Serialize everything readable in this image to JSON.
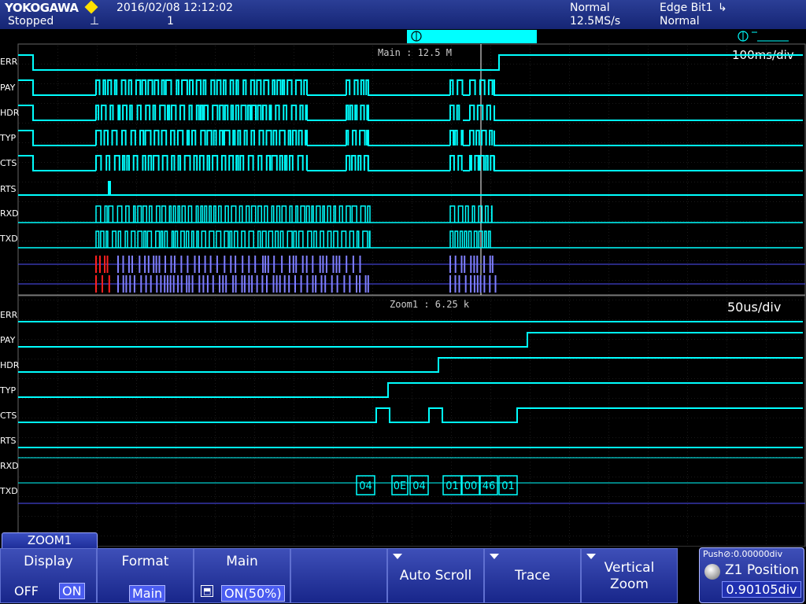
{
  "status": {
    "brand": "YOKOGAWA",
    "state": "Stopped",
    "datetime": "2016/02/08  12:12:02",
    "acq_count": "1",
    "mode": "Normal",
    "sample_rate": "12.5MS/s",
    "trigger_type": "Edge Bit1",
    "trigger_mode": "Normal"
  },
  "main_window": {
    "label": "Main : 12.5 M",
    "timebase": "100ms/div",
    "channels": [
      "ERR",
      "PAY",
      "HDR",
      "TYP",
      "CTS",
      "RTS",
      "RXD",
      "TXD"
    ]
  },
  "zoom_window": {
    "label": "Zoom1 : 6.25 k",
    "timebase": "50us/div",
    "channels": [
      "ERR",
      "PAY",
      "HDR",
      "TYP",
      "CTS",
      "RTS",
      "RXD",
      "TXD"
    ],
    "decode_bytes": [
      "04",
      "0E",
      "04",
      "01",
      "00",
      "46",
      "01"
    ]
  },
  "menu": {
    "tab_title": "ZOOM1",
    "display": {
      "label": "Display",
      "off": "OFF",
      "on": "ON"
    },
    "format": {
      "label": "Format",
      "value": "Main"
    },
    "main": {
      "label": "Main",
      "value": "ON(50%)"
    },
    "auto_scroll": {
      "label": "Auto Scroll"
    },
    "trace": {
      "label": "Trace"
    },
    "vertical_zoom": {
      "label": "Vertical",
      "label2": "Zoom"
    },
    "position": {
      "push_hint": "Push⊘:0.00000div",
      "label": "Z1 Position",
      "value": "0.90105div"
    }
  },
  "colors": {
    "trace": "#00ffff",
    "grid": "#2a2a2a",
    "decode": "#8080ff",
    "error": "#ff2020"
  }
}
